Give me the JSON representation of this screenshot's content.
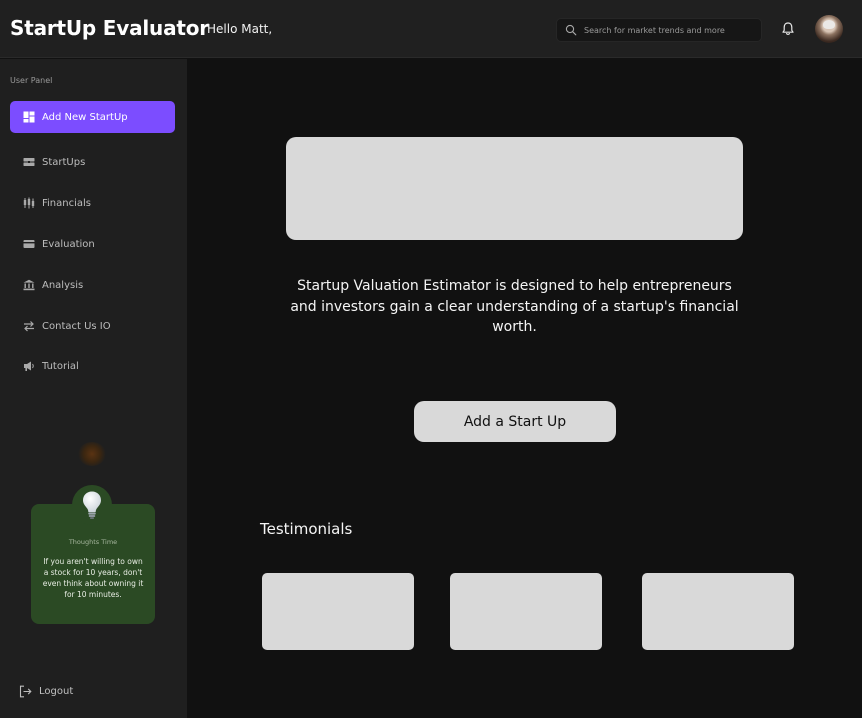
{
  "header": {
    "brand": "StartUp Evaluator",
    "greeting": "Hello Matt,",
    "search_placeholder": "Search for market trends and more"
  },
  "sidebar": {
    "panel_label": "User Panel",
    "items": [
      {
        "label": "Add New StartUp",
        "icon": "dashboard-grid-icon",
        "active": true
      },
      {
        "label": "StartUps",
        "icon": "startups-icon"
      },
      {
        "label": "Financials",
        "icon": "candlestick-icon"
      },
      {
        "label": "Evaluation",
        "icon": "card-icon"
      },
      {
        "label": "Analysis",
        "icon": "bank-icon"
      },
      {
        "label": "Contact Us IO",
        "icon": "swap-arrows-icon"
      },
      {
        "label": "Tutorial",
        "icon": "megaphone-icon"
      }
    ],
    "thoughts": {
      "title": "Thoughts Time",
      "quote": "If you aren't willing to own a stock for 10 years, don't even think about owning it for 10 minutes."
    },
    "logout_label": "Logout"
  },
  "main": {
    "intro": "Startup Valuation Estimator is designed to help entrepreneurs and investors gain a clear understanding of a startup's financial worth.",
    "add_button": "Add a Start Up",
    "testimonials_title": "Testimonials"
  },
  "colors": {
    "accent": "#7c4dff",
    "sidebar_bg": "#1f1f1f",
    "main_bg": "#111111",
    "card_placeholder": "#d9d9d9",
    "thought_card_bg": "#2b4a24"
  }
}
